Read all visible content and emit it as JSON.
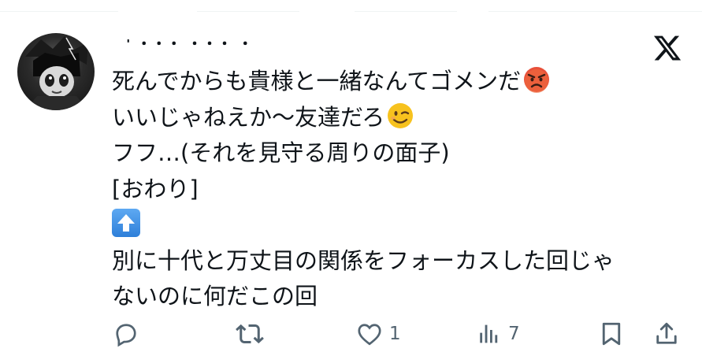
{
  "tweet": {
    "author_line": "  ' ・・・        ・・・    ・",
    "lines": [
      {
        "text": "死んでからも貴様と一緒なんてゴメンだ",
        "emoji": "angry-face"
      },
      {
        "text": "いいじゃねえか〜友達だろ",
        "emoji": "winking-face"
      },
      {
        "text": "フフ…(それを見守る周りの面子)"
      },
      {
        "text": "[おわり]"
      },
      {
        "text": "",
        "emoji": "up-arrow"
      },
      {
        "text": "別に十代と万丈目の関係をフォーカスした回じゃ"
      },
      {
        "text": "ないのに何だこの回"
      }
    ]
  },
  "actions": {
    "reply": {
      "icon": "reply-icon",
      "count": ""
    },
    "retweet": {
      "icon": "retweet-icon",
      "count": ""
    },
    "like": {
      "icon": "heart-icon",
      "count": "1"
    },
    "views": {
      "icon": "views-icon",
      "count": "7"
    },
    "bookmark": {
      "icon": "bookmark-icon",
      "count": ""
    },
    "share": {
      "icon": "share-icon",
      "count": ""
    }
  },
  "colors": {
    "text": "#0f1419",
    "muted": "#536471",
    "divider": "#eff3f4",
    "emoji_yellow": "#f7c21e",
    "emoji_red": "#e8503a",
    "arrow_blue": "#3d8fe0"
  }
}
